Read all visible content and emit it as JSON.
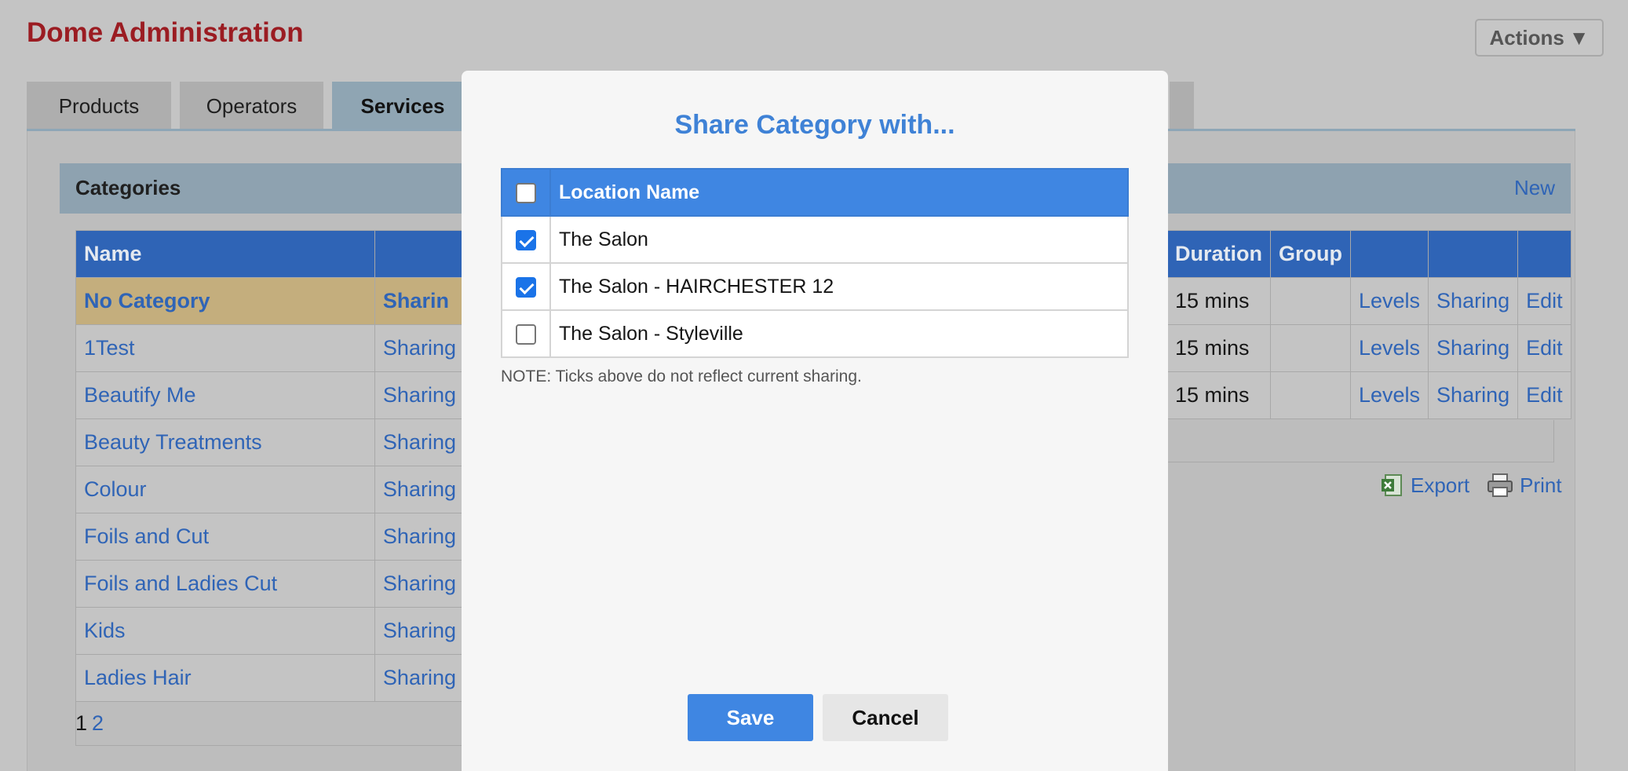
{
  "app": {
    "title": "Dome Administration",
    "actions_label": "Actions",
    "actions_arrow": "▼"
  },
  "tabs": [
    {
      "label": "Products"
    },
    {
      "label": "Operators"
    },
    {
      "label": "Services",
      "active": true
    }
  ],
  "categories": {
    "title": "Categories",
    "new_label": "New",
    "columns": {
      "name": "Name"
    },
    "rows": [
      {
        "name": "No Category",
        "sharing": "Sharin",
        "highlight": true
      },
      {
        "name": "1Test",
        "sharing": "Sharing"
      },
      {
        "name": "Beautify Me",
        "sharing": "Sharing"
      },
      {
        "name": "Beauty Treatments",
        "sharing": "Sharing"
      },
      {
        "name": "Colour",
        "sharing": "Sharing"
      },
      {
        "name": "Foils and Cut",
        "sharing": "Sharing"
      },
      {
        "name": "Foils and Ladies Cut",
        "sharing": "Sharing"
      },
      {
        "name": "Kids",
        "sharing": "Sharing"
      },
      {
        "name": "Ladies Hair",
        "sharing": "Sharing"
      }
    ],
    "pager": {
      "current": "1",
      "next": "2"
    }
  },
  "services": {
    "columns": {
      "duration": "Duration",
      "group": "Group"
    },
    "rows": [
      {
        "duration": "15 mins",
        "levels": "Levels",
        "sharing": "Sharing",
        "edit": "Edit"
      },
      {
        "duration": "15 mins",
        "levels": "Levels",
        "sharing": "Sharing",
        "edit": "Edit"
      },
      {
        "duration": "15 mins",
        "levels": "Levels",
        "sharing": "Sharing",
        "edit": "Edit"
      }
    ],
    "export_label": "Export",
    "print_label": "Print"
  },
  "modal": {
    "title": "Share Category with...",
    "column_header": "Location Name",
    "locations": [
      {
        "name": "The Salon",
        "checked": true
      },
      {
        "name": "The Salon - HAIRCHESTER 12",
        "checked": true
      },
      {
        "name": "The Salon - Styleville",
        "checked": false
      }
    ],
    "note": "NOTE: Ticks above do not reflect current sharing.",
    "save_label": "Save",
    "cancel_label": "Cancel"
  },
  "colors": {
    "brand_red": "#9b1c22",
    "link_blue": "#2f64b6",
    "modal_accent": "#3f86e2"
  }
}
